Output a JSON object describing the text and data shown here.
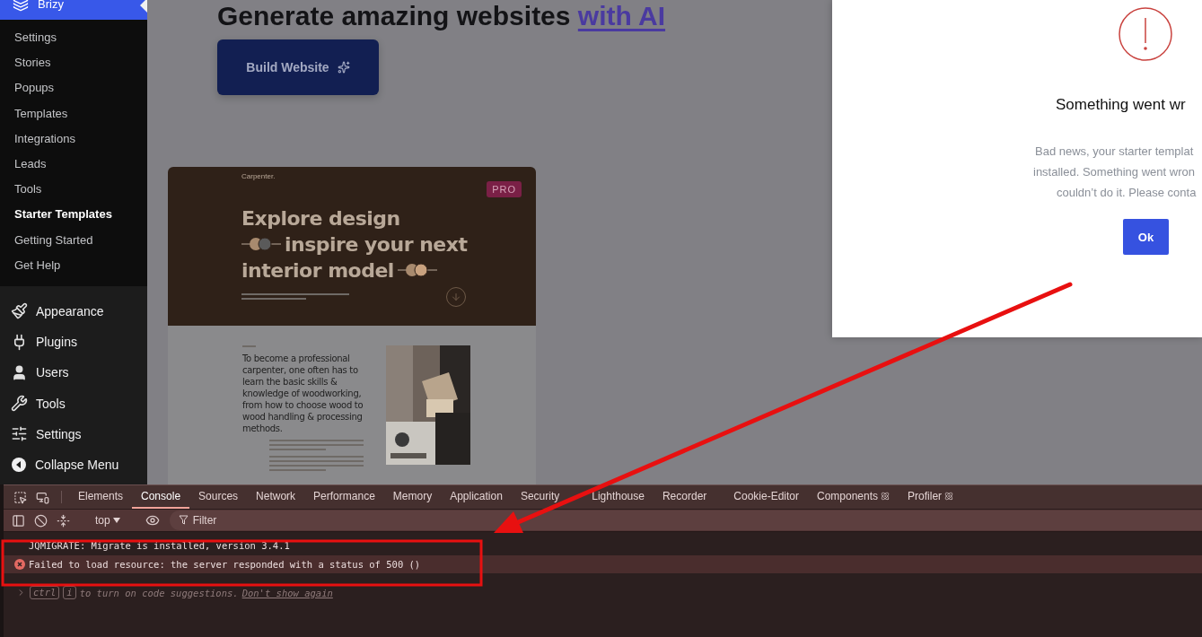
{
  "sidebar": {
    "brand": "Brizy",
    "submenu": [
      {
        "label": "Settings",
        "selected": false
      },
      {
        "label": "Stories",
        "selected": false
      },
      {
        "label": "Popups",
        "selected": false
      },
      {
        "label": "Templates",
        "selected": false
      },
      {
        "label": "Integrations",
        "selected": false
      },
      {
        "label": "Leads",
        "selected": false
      },
      {
        "label": "Tools",
        "selected": false
      },
      {
        "label": "Starter Templates",
        "selected": true
      },
      {
        "label": "Getting Started",
        "selected": false
      },
      {
        "label": "Get Help",
        "selected": false
      }
    ],
    "menu": [
      {
        "label": "Appearance"
      },
      {
        "label": "Plugins"
      },
      {
        "label": "Users"
      },
      {
        "label": "Tools"
      },
      {
        "label": "Settings"
      },
      {
        "label": "Collapse Menu"
      }
    ]
  },
  "main": {
    "heading": {
      "text": "Generate amazing websites",
      "accent": "with AI"
    },
    "build_button": "Build Website",
    "template_card": {
      "brand": "Carpenter.",
      "badge": "PRO",
      "headline": [
        "Explore design",
        "inspire your next",
        "interior model"
      ],
      "body": "To become a professional carpenter, one often has to learn the basic skills & knowledge of woodworking, from how to choose wood to wood handling & processing methods."
    }
  },
  "modal": {
    "title": "Something went wr",
    "message": [
      "Bad news, your starter templat",
      "installed. Something went wron",
      "couldn’t do it. Please conta"
    ],
    "button": "Ok"
  },
  "devtools": {
    "tabs": [
      {
        "label": "Elements",
        "selected": false,
        "react_icon": false
      },
      {
        "label": "Console",
        "selected": true,
        "react_icon": false
      },
      {
        "label": "Sources",
        "selected": false,
        "react_icon": false
      },
      {
        "label": "Network",
        "selected": false,
        "react_icon": false
      },
      {
        "label": "Performance",
        "selected": false,
        "react_icon": false
      },
      {
        "label": "Memory",
        "selected": false,
        "react_icon": false
      },
      {
        "label": "Application",
        "selected": false,
        "react_icon": false
      },
      {
        "label": "Security",
        "selected": false,
        "react_icon": false
      },
      {
        "label": "Lighthouse",
        "selected": false,
        "react_icon": false
      },
      {
        "label": "Recorder",
        "selected": false,
        "react_icon": false
      },
      {
        "label": "Cookie-Editor",
        "selected": false,
        "react_icon": false
      },
      {
        "label": "Components",
        "selected": false,
        "react_icon": true
      },
      {
        "label": "Profiler",
        "selected": false,
        "react_icon": true
      }
    ],
    "toolbar": {
      "context": "top",
      "filter": {
        "placeholder": "Filter"
      }
    },
    "messages": [
      {
        "kind": "log",
        "text": "JQMIGRATE: Migrate is installed, version 3.4.1"
      },
      {
        "kind": "error",
        "text": "Failed to load resource: the server responded with a status of 500 ()"
      }
    ],
    "prompt": {
      "keys": [
        "ctrl",
        "i"
      ],
      "hint": "to turn on code suggestions.",
      "link": "Don't show again"
    }
  }
}
